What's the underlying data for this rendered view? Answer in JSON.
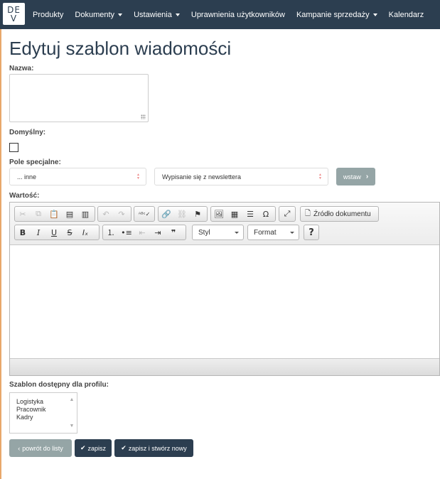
{
  "navbar": {
    "logo_line1": "DE",
    "logo_line2": "V",
    "items": [
      {
        "label": "Produkty",
        "dropdown": false
      },
      {
        "label": "Dokumenty",
        "dropdown": true
      },
      {
        "label": "Ustawienia",
        "dropdown": true
      },
      {
        "label": "Uprawnienia użytkowników",
        "dropdown": false
      },
      {
        "label": "Kampanie sprzedaży",
        "dropdown": true
      },
      {
        "label": "Kalendarz",
        "dropdown": false
      }
    ]
  },
  "page": {
    "title": "Edytuj szablon wiadomości"
  },
  "form": {
    "name_label": "Nazwa:",
    "name_value": "",
    "default_label": "Domyślny:",
    "default_checked": false,
    "special_field_label": "Pole specjalne:",
    "special_field_select": "... inne",
    "special_field_option": "Wypisanie się z newslettera",
    "insert_button": "wstaw",
    "value_label": "Wartość:"
  },
  "editor": {
    "source_button": "Źródło dokumentu",
    "style_combo": "Styl",
    "format_combo": "Format",
    "content": ""
  },
  "profile": {
    "label": "Szablon dostępny dla profilu:",
    "options": [
      "Logistyka",
      "Pracownik",
      "Kadry"
    ]
  },
  "actions": {
    "back": "powrót do listy",
    "save": "zapisz",
    "save_new": "zapisz i stwórz nowy"
  },
  "colors": {
    "navbar": "#2c3e50",
    "primary_button": "#2c3e50",
    "secondary_button": "#95a5a6"
  }
}
